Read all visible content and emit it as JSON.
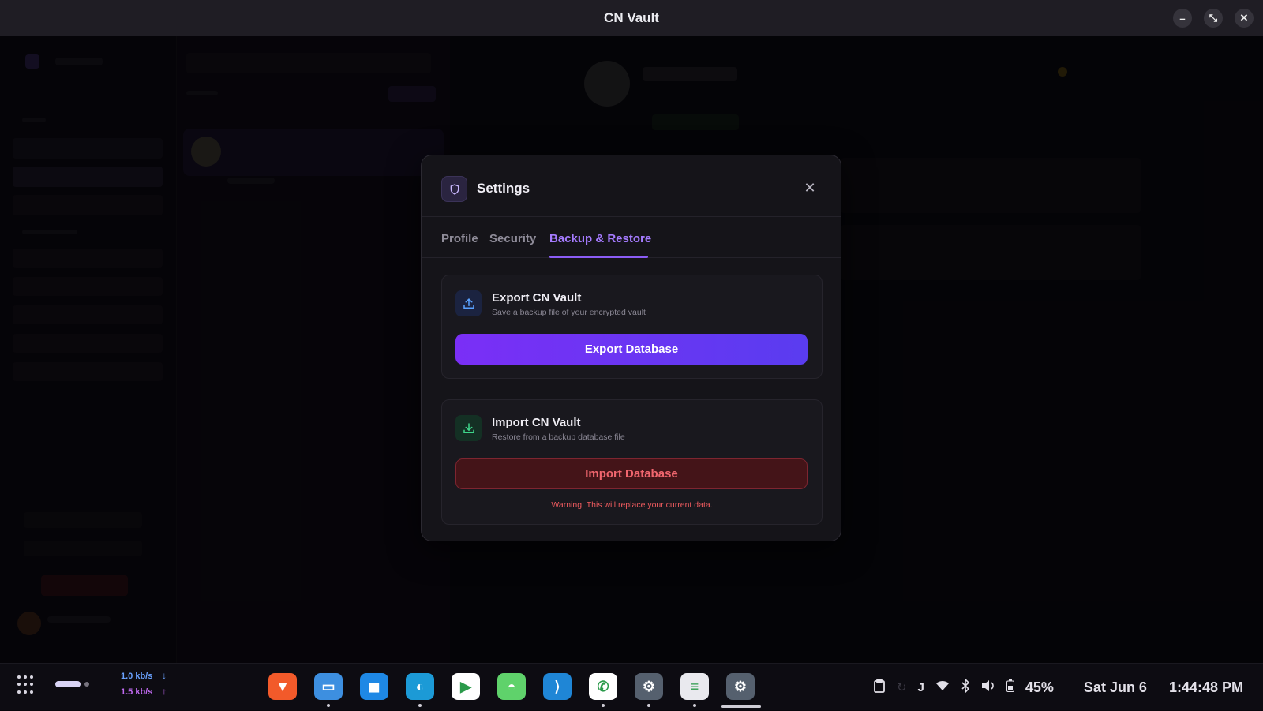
{
  "window": {
    "title": "CN Vault",
    "controls": [
      "minimize-icon",
      "restore-icon",
      "close-icon"
    ]
  },
  "settings_modal": {
    "title": "Settings",
    "icon": "shield-icon",
    "tabs": [
      {
        "label": "Profile",
        "active": false
      },
      {
        "label": "Security",
        "active": false
      },
      {
        "label": "Backup & Restore",
        "active": true
      }
    ],
    "export_card": {
      "icon": "upload-icon",
      "title": "Export CN Vault",
      "subtitle": "Save a backup file of your encrypted vault",
      "button_label": "Export Database"
    },
    "import_card": {
      "icon": "download-icon",
      "title": "Import CN Vault",
      "subtitle": "Restore from a backup database file",
      "button_label": "Import Database",
      "warning": "Warning: This will replace your current data."
    }
  },
  "taskbar": {
    "net_down": "1.0 kb/s",
    "net_up": "1.5 kb/s",
    "apps": [
      {
        "name": "brave-icon",
        "color": "#f25a2a",
        "running": false
      },
      {
        "name": "files-icon",
        "color": "#3d8fe0",
        "running": true
      },
      {
        "name": "store-icon",
        "color": "#1e88e5",
        "running": false
      },
      {
        "name": "edge-icon",
        "color": "#1c9ad6",
        "running": true
      },
      {
        "name": "play-store-icon",
        "color": "#ffffff",
        "running": false
      },
      {
        "name": "android-icon",
        "color": "#5fd26b",
        "running": false
      },
      {
        "name": "vscode-icon",
        "color": "#1f86d6",
        "running": false
      },
      {
        "name": "whatsapp-icon",
        "color": "#ffffff",
        "running": true
      },
      {
        "name": "settings-app-icon",
        "color": "#55606e",
        "running": true
      },
      {
        "name": "text-editor-icon",
        "color": "#e9e9ee",
        "running": true
      },
      {
        "name": "settings-app-active-icon",
        "color": "#55606e",
        "running": true
      }
    ],
    "battery": "45%",
    "date": "Sat Jun 6",
    "time": "1:44:48 PM"
  },
  "colors": {
    "accent": "#8b5cf6",
    "danger": "#f0666e"
  }
}
